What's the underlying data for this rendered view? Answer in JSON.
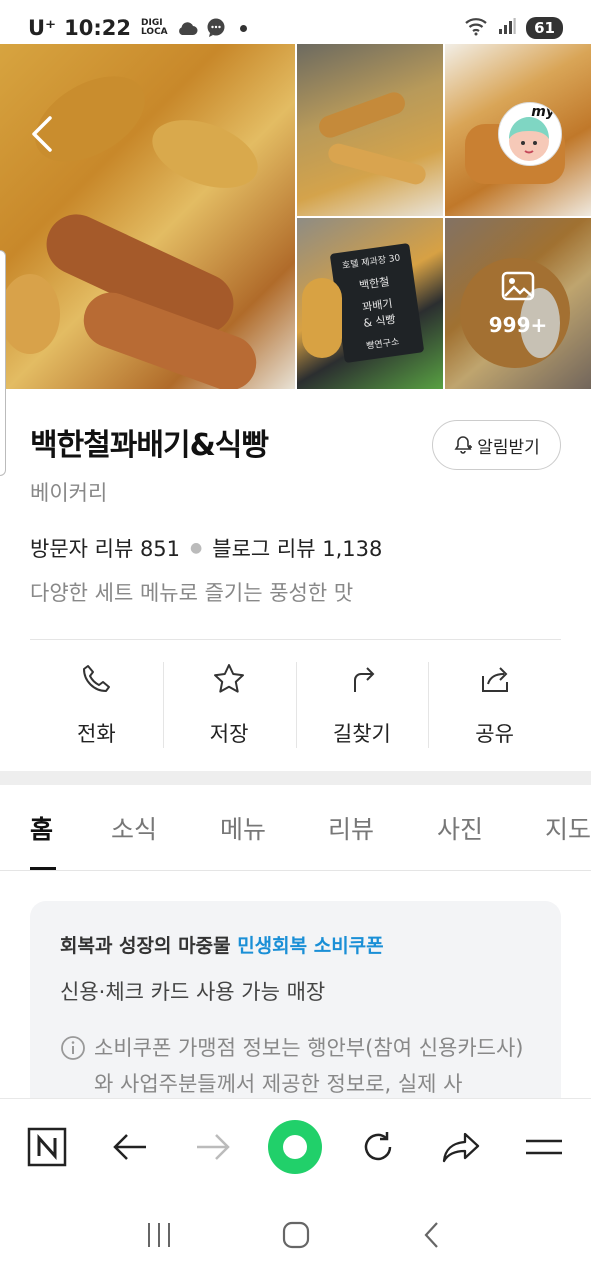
{
  "status": {
    "carrier": "U⁺",
    "time": "10:22",
    "digi_top": "DIGI",
    "digi_bottom": "LOCA",
    "battery": "61"
  },
  "gallery": {
    "more_count": "999+",
    "sign_lines": [
      "호텔 제과장 30",
      "백한철",
      "꽈배기",
      "& 식빵",
      "빵연구소"
    ],
    "badge_text": "my"
  },
  "place": {
    "name": "백한철꽈배기&식빵",
    "alarm_label": "알림받기",
    "category": "베이커리",
    "visitor_review": "방문자 리뷰 851",
    "blog_review": "블로그 리뷰 1,138",
    "tagline": "다양한 세트 메뉴로 즐기는 풍성한 맛"
  },
  "actions": [
    {
      "label": "전화",
      "icon": "phone-icon"
    },
    {
      "label": "저장",
      "icon": "star-icon"
    },
    {
      "label": "길찾기",
      "icon": "directions-icon"
    },
    {
      "label": "공유",
      "icon": "share-icon"
    }
  ],
  "tabs": [
    "홈",
    "소식",
    "메뉴",
    "리뷰",
    "사진",
    "지도"
  ],
  "notice": {
    "head_prefix": "회복과 성장의 마중물",
    "head_highlight": "민생회복 소비쿠폰",
    "sub": "신용·체크 카드 사용 가능 매장",
    "body": "소비쿠폰 가맹점 정보는 행안부(참여 신용카드사)와 사업주분들께서 제공한 정보로, 실제 사"
  },
  "colors": {
    "accent_green": "#21d06a",
    "highlight_blue": "#1a8fd6"
  }
}
